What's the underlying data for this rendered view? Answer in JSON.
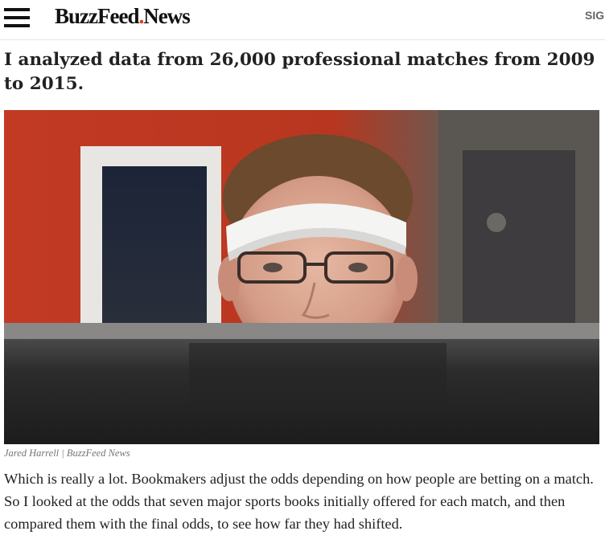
{
  "header": {
    "logo_main": "BuzzFeed",
    "logo_dot": ".",
    "logo_sub": "News",
    "signin_label": "SIG"
  },
  "article": {
    "headline": "I analyzed data from 26,000 professional matches from 2009 to 2015.",
    "image_credit": "Jared Harrell | BuzzFeed News",
    "paragraph": "Which is really a lot. Bookmakers adjust the odds depending on how people are betting on a match. So I looked at the odds that seven major sports books initially offered for each match, and then compared them with the final odds, to see how far they had shifted."
  },
  "icons": {
    "menu": "hamburger-menu-icon"
  },
  "colors": {
    "text": "#222222",
    "logo_dot": "#ee3322",
    "caption": "#757575",
    "header_border": "#e4e4e4"
  }
}
